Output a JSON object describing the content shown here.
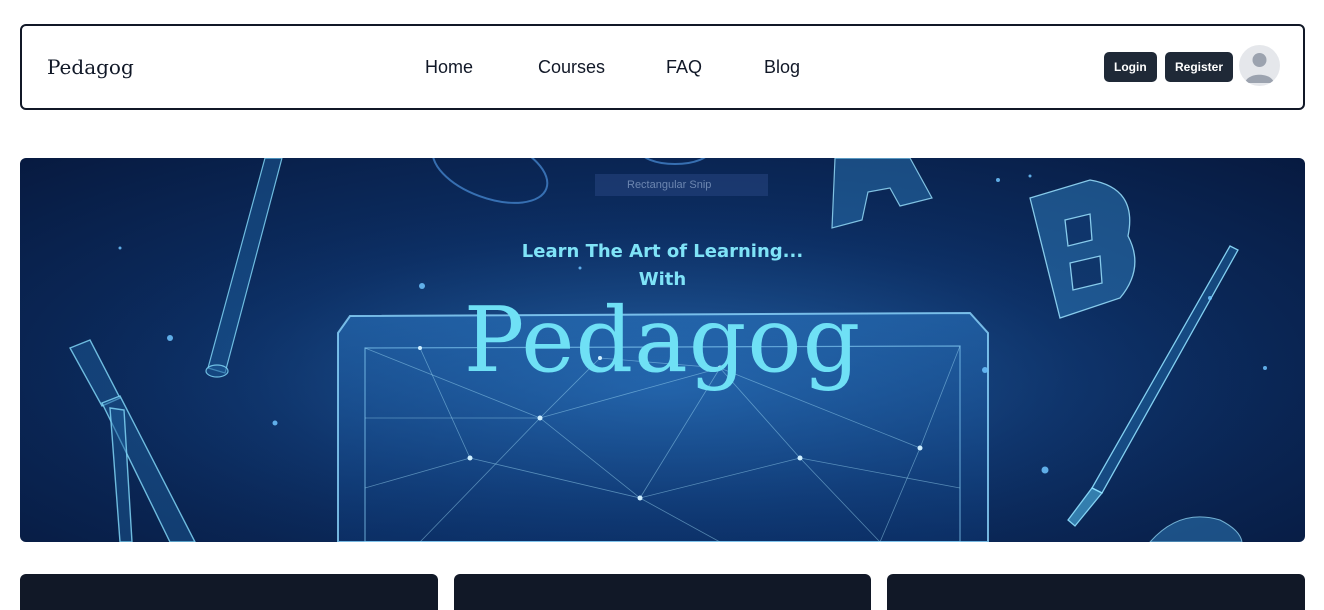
{
  "navbar": {
    "brand": "Pedagog",
    "links": [
      "Home",
      "Courses",
      "FAQ",
      "Blog"
    ],
    "login_label": "Login",
    "register_label": "Register",
    "avatar_icon": "user-avatar-icon"
  },
  "hero": {
    "overlay_label": "Rectangular Snip",
    "tagline_line1": "Learn The Art of Learning...",
    "tagline_line2": "With",
    "title": "Pedagog",
    "colors": {
      "background": "#0c2e63",
      "accent": "#6fe0f5"
    }
  },
  "cards": {
    "count": 3,
    "color": "#111827"
  }
}
